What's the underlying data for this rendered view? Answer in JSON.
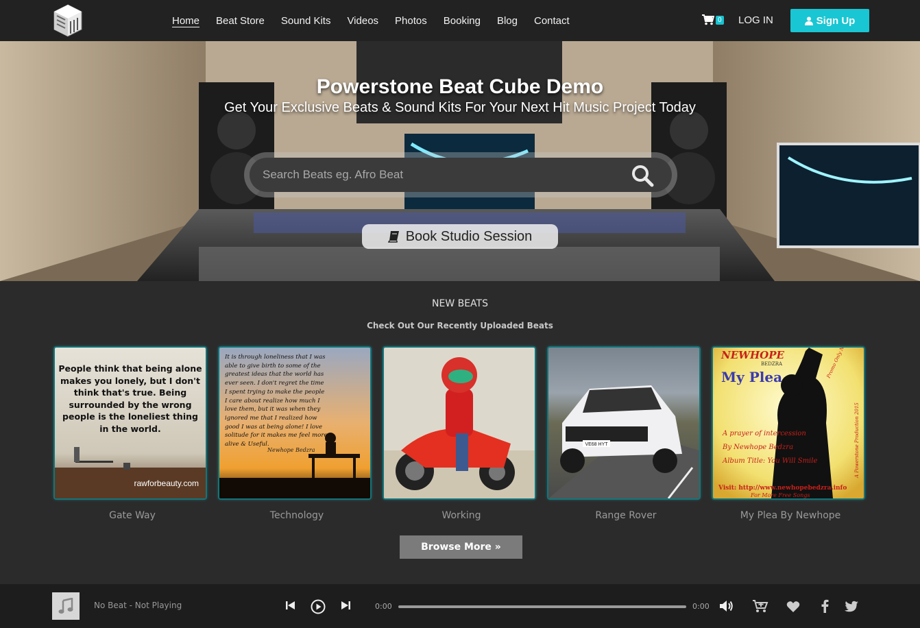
{
  "nav": {
    "links": [
      "Home",
      "Beat Store",
      "Sound Kits",
      "Videos",
      "Photos",
      "Booking",
      "Blog",
      "Contact"
    ],
    "cart_count": "0",
    "login": "LOG IN",
    "signup": "Sign Up"
  },
  "hero": {
    "title": "Powerstone Beat Cube Demo",
    "subtitle": "Get Your Exclusive Beats & Sound Kits For Your Next Hit Music Project Today",
    "search_placeholder": "Search Beats eg. Afro Beat",
    "book_button": "Book Studio Session"
  },
  "new_beats": {
    "title": "NEW BEATS",
    "subtitle": "Check Out Our Recently Uploaded Beats",
    "items": [
      {
        "name": "Gate Way",
        "cover_text": "People think that being alone makes you lonely, but I don't think that's true. Being surrounded by the wrong people is the loneliest thing in the world.",
        "cover_credit": "rawforbeauty.com"
      },
      {
        "name": "Technology",
        "cover_text": "It is through loneliness that I was able to give birth to some of the greatest ideas that the world has ever seen. I don't regret the time I spent trying to make the people I care about realize how much I love them, but it was when they ignored me that I realized how good I was at being alone! I love solitude for it makes me feel more alive & Useful.",
        "cover_credit": "Newhope Bedzra"
      },
      {
        "name": "Working",
        "cover_text": "",
        "cover_credit": ""
      },
      {
        "name": "Range Rover",
        "cover_text": "",
        "cover_credit": "",
        "plate": "VE68 HYT"
      },
      {
        "name": "My Plea By Newhope",
        "cover_brand": "NEWHOPE",
        "cover_brand_sub": "BEDZRA",
        "cover_title": "My Plea",
        "cover_lines": [
          "A prayer of intercession",
          "By Newhope Bedzra",
          "Album Title: You Will Smile"
        ],
        "cover_url": "Visit: http://www.newhopebedzra.info",
        "cover_more": "For More Free Songs",
        "cover_side": "A Powerstone Production 2015",
        "cover_corner": "Promo Only Not For Sale!!"
      }
    ],
    "browse_button": "Browse More »"
  },
  "player": {
    "now_playing_title": "No Beat",
    "now_playing_status": "Not Playing",
    "time_current": "0:00",
    "time_total": "0:00",
    "progress": 0
  },
  "colors": {
    "accent": "#18c7d3",
    "navbar": "#222222",
    "body": "#2b2b2b",
    "player": "#1d1d1d"
  }
}
